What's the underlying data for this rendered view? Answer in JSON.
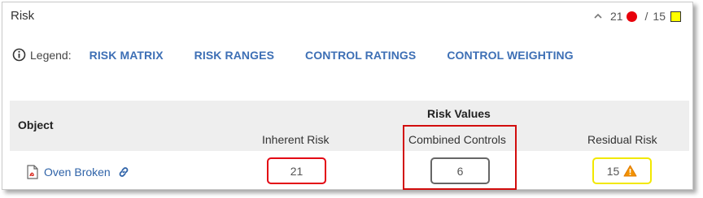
{
  "panel": {
    "title": "Risk",
    "summary": {
      "inherent_count": "21",
      "separator": "/",
      "residual_count": "15",
      "inherent_color": "#e8000b",
      "residual_color": "#ffff00",
      "collapse_icon": "chevron-up-icon"
    }
  },
  "legend": {
    "label": "Legend:",
    "icon": "info-icon",
    "links": [
      {
        "label": "RISK MATRIX"
      },
      {
        "label": "RISK RANGES"
      },
      {
        "label": "CONTROL RATINGS"
      },
      {
        "label": "CONTROL WEIGHTING"
      }
    ]
  },
  "table": {
    "object_header": "Object",
    "group_header": "Risk Values",
    "columns": [
      "Inherent Risk",
      "Combined Controls",
      "Residual Risk"
    ],
    "rows": [
      {
        "object": "Oven Broken",
        "object_icon": "pdf-document-icon",
        "link_icon": "link-icon",
        "inherent": "21",
        "inherent_color": "#e30613",
        "combined": "6",
        "combined_color": "#666666",
        "residual": "15",
        "residual_color": "#f2e800",
        "residual_icon": "warning-icon"
      }
    ]
  },
  "accent_color": "#3d6fb5"
}
